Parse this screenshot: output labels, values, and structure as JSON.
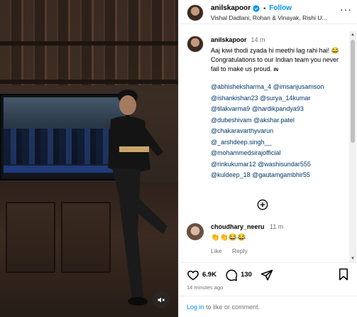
{
  "header": {
    "username": "anilskapoor",
    "follow_label": "Follow",
    "collaborators": "Vishal Dadlani, Rohan & Vinayak, Rishi U...",
    "more_label": "···"
  },
  "caption": {
    "username": "anilskapoor",
    "time": "14 m",
    "text": "Aaj kiwi thodi zyada hi meethi lag rahi hai! 😂\nCongratulations to our Indian team you never fail to make us proud. ",
    "lang_tag": "IN",
    "mentions": [
      "@abhisheksharma_4 @imsanjusamson",
      "@ishankishan23 @surya_14kumar",
      "@tilakvarma9 @hardikpandya93",
      "@dubeshivam @akshar.patel",
      "@chakaravarthyvarun",
      "@_arshdeep.singh__",
      "@mohammedsirajofficial",
      "@rinkukumar12 @washisundar555",
      "@kuldeep_18 @gautamgambhir55"
    ]
  },
  "comment": {
    "username": "choudhary_neeru",
    "time": "11 m",
    "text": "👏👏😂😂",
    "like_label": "Like",
    "reply_label": "Reply"
  },
  "stats": {
    "likes": "6.9K",
    "comments": "130"
  },
  "time_ago": "14 minutes ago",
  "login": {
    "link": "Log in",
    "text": " to like or comment."
  },
  "colors": {
    "accent": "#0095f6",
    "mention": "#00376b",
    "muted": "#737373"
  }
}
